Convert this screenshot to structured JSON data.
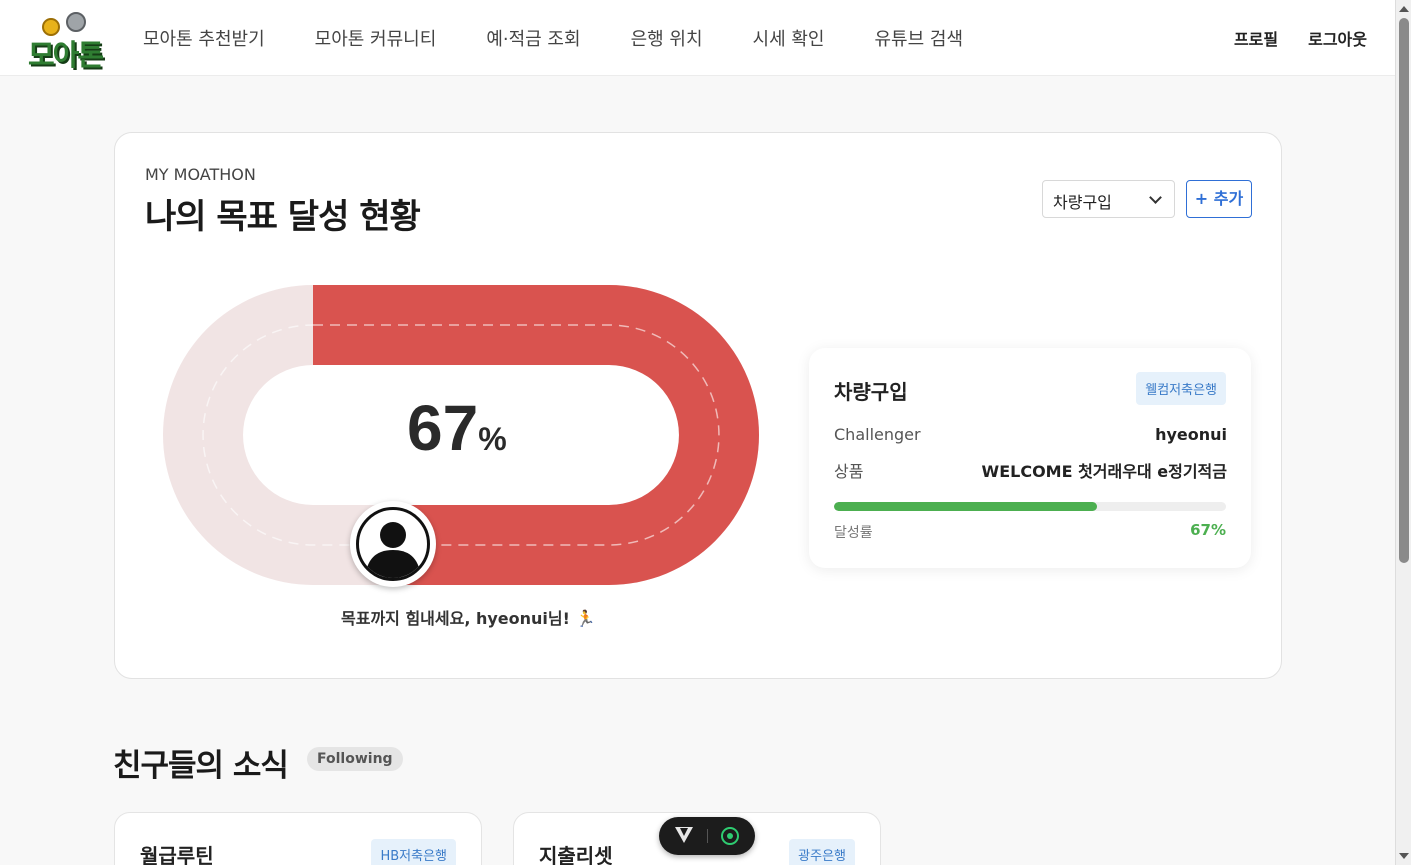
{
  "header": {
    "logo_text": "모아톤",
    "nav": [
      "모아톤 추천받기",
      "모아톤 커뮤니티",
      "예·적금 조회",
      "은행 위치",
      "시세 확인",
      "유튜브 검색"
    ],
    "profile_label": "프로필",
    "logout_label": "로그아웃"
  },
  "goal": {
    "eyebrow": "MY MOATHON",
    "title": "나의 목표 달성 현황",
    "selected_goal": "차량구입",
    "add_label": "+ 추가",
    "progress_pct": 67,
    "pct_number": "67",
    "pct_unit": "%",
    "cheer_text": "목표까지 힘내세요, hyeonui님!",
    "cheer_icon": "runner-icon"
  },
  "info": {
    "title": "차량구입",
    "bank": "웰컴저축은행",
    "challenger_label": "Challenger",
    "challenger_value": "hyeonui",
    "product_label": "상품",
    "product_value": "WELCOME 첫거래우대 e정기적금",
    "rate_label": "달성률",
    "rate_value": "67%",
    "rate_fraction": 0.67
  },
  "friends": {
    "title": "친구들의 소식",
    "badge": "Following",
    "cards": [
      {
        "title": "월급루틴",
        "bank": "HB저축은행"
      },
      {
        "title": "지출리셋",
        "bank": "광주은행"
      }
    ]
  },
  "colors": {
    "track_fill": "#d9534f",
    "track_empty": "#f1e4e4",
    "accent_blue": "#2f6fd6",
    "progress_green": "#4caf50"
  }
}
